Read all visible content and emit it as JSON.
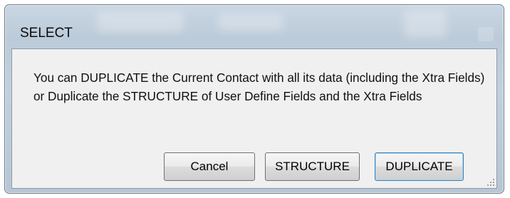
{
  "dialog": {
    "title": "SELECT",
    "message": "You can DUPLICATE the Current Contact with all its data (including the Xtra Fields) or Duplicate the STRUCTURE of User Define Fields and the Xtra Fields",
    "buttons": {
      "cancel": "Cancel",
      "structure": "STRUCTURE",
      "duplicate": "DUPLICATE"
    },
    "default_button": "duplicate"
  },
  "colors": {
    "frame": "#bccbd9",
    "client_background": "#f0f0f0",
    "default_button_border": "#3c7fb1"
  },
  "icons": {
    "close": "close-icon",
    "resize": "resize-grip-icon"
  }
}
